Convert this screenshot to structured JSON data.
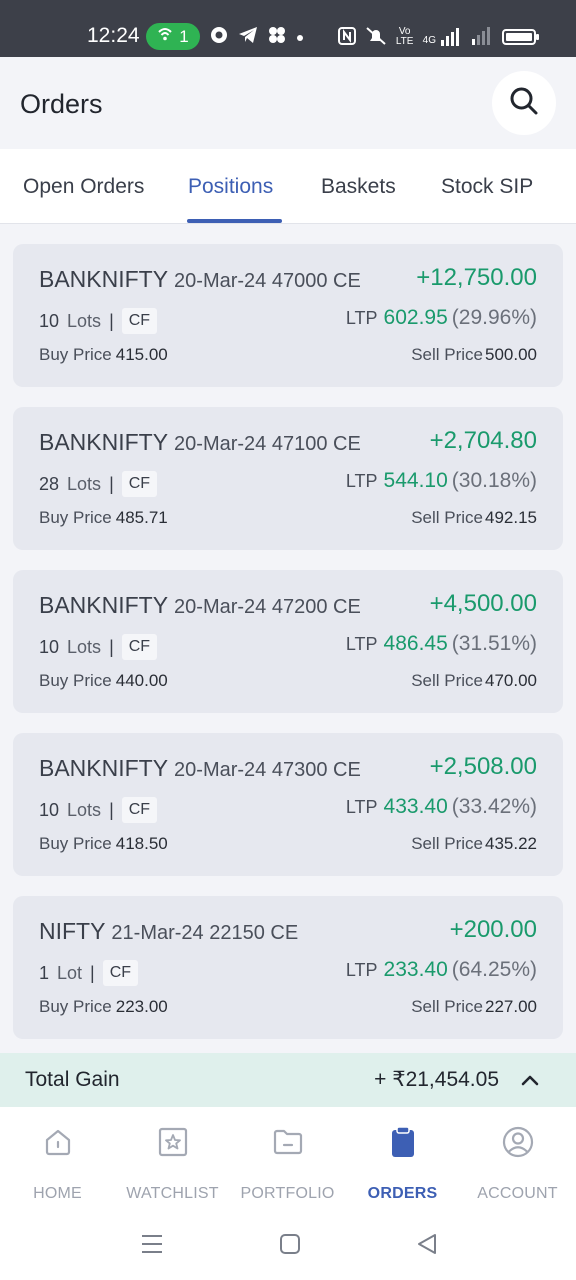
{
  "status_bar": {
    "time": "12:24",
    "hotspot_count": "1",
    "icons": [
      "hotspot-icon",
      "chrome-icon",
      "telegram-icon",
      "app-icon",
      "dot-icon",
      "nfc-icon",
      "mute-icon",
      "volte-icon",
      "4g-signal-icon",
      "signal-icon",
      "battery-icon"
    ],
    "volte_label": "Vo LTE",
    "net_label": "4G"
  },
  "header": {
    "title": "Orders",
    "search_icon": "search-icon"
  },
  "tabs": [
    {
      "label": "Open Orders",
      "active": false
    },
    {
      "label": "Positions",
      "active": true
    },
    {
      "label": "Baskets",
      "active": false
    },
    {
      "label": "Stock SIP",
      "active": false
    }
  ],
  "positions": [
    {
      "symbol": "BANKNIFTY",
      "contract": "20-Mar-24 47000 CE",
      "pnl": "+12,750.00",
      "qty": "10",
      "qty_unit": "Lots",
      "tag": "CF",
      "ltp_label": "LTP",
      "ltp": "602.95",
      "ltp_change": "(29.96%)",
      "buy_label": "Buy Price",
      "buy_price": "415.00",
      "sell_label": "Sell Price",
      "sell_price": "500.00"
    },
    {
      "symbol": "BANKNIFTY",
      "contract": "20-Mar-24 47100 CE",
      "pnl": "+2,704.80",
      "qty": "28",
      "qty_unit": "Lots",
      "tag": "CF",
      "ltp_label": "LTP",
      "ltp": "544.10",
      "ltp_change": "(30.18%)",
      "buy_label": "Buy Price",
      "buy_price": "485.71",
      "sell_label": "Sell Price",
      "sell_price": "492.15"
    },
    {
      "symbol": "BANKNIFTY",
      "contract": "20-Mar-24 47200 CE",
      "pnl": "+4,500.00",
      "qty": "10",
      "qty_unit": "Lots",
      "tag": "CF",
      "ltp_label": "LTP",
      "ltp": "486.45",
      "ltp_change": "(31.51%)",
      "buy_label": "Buy Price",
      "buy_price": "440.00",
      "sell_label": "Sell Price",
      "sell_price": "470.00"
    },
    {
      "symbol": "BANKNIFTY",
      "contract": "20-Mar-24 47300 CE",
      "pnl": "+2,508.00",
      "qty": "10",
      "qty_unit": "Lots",
      "tag": "CF",
      "ltp_label": "LTP",
      "ltp": "433.40",
      "ltp_change": "(33.42%)",
      "buy_label": "Buy Price",
      "buy_price": "418.50",
      "sell_label": "Sell Price",
      "sell_price": "435.22"
    },
    {
      "symbol": "NIFTY",
      "contract": "21-Mar-24 22150 CE",
      "pnl": "+200.00",
      "qty": "1",
      "qty_unit": "Lot",
      "tag": "CF",
      "ltp_label": "LTP",
      "ltp": "233.40",
      "ltp_change": "(64.25%)",
      "buy_label": "Buy Price",
      "buy_price": "223.00",
      "sell_label": "Sell Price",
      "sell_price": "227.00"
    }
  ],
  "summary": {
    "label": "Total Gain",
    "value": "+ ₹21,454.05",
    "toggle_icon": "chevron-up-icon"
  },
  "bottom_nav": [
    {
      "label": "HOME",
      "icon": "home-icon",
      "active": false
    },
    {
      "label": "WATCHLIST",
      "icon": "star-icon",
      "active": false
    },
    {
      "label": "PORTFOLIO",
      "icon": "folder-icon",
      "active": false
    },
    {
      "label": "ORDERS",
      "icon": "clipboard-icon",
      "active": true
    },
    {
      "label": "ACCOUNT",
      "icon": "user-icon",
      "active": false
    }
  ],
  "system_nav": [
    "menu-icon",
    "home-square-icon",
    "back-icon"
  ],
  "colors": {
    "accent": "#3d5fb4",
    "gain": "#1a9a6c",
    "card_bg": "#e6e8ef",
    "summary_bg": "#dff0ec",
    "status_bar": "#3d4049",
    "hotspot": "#2fb353"
  }
}
